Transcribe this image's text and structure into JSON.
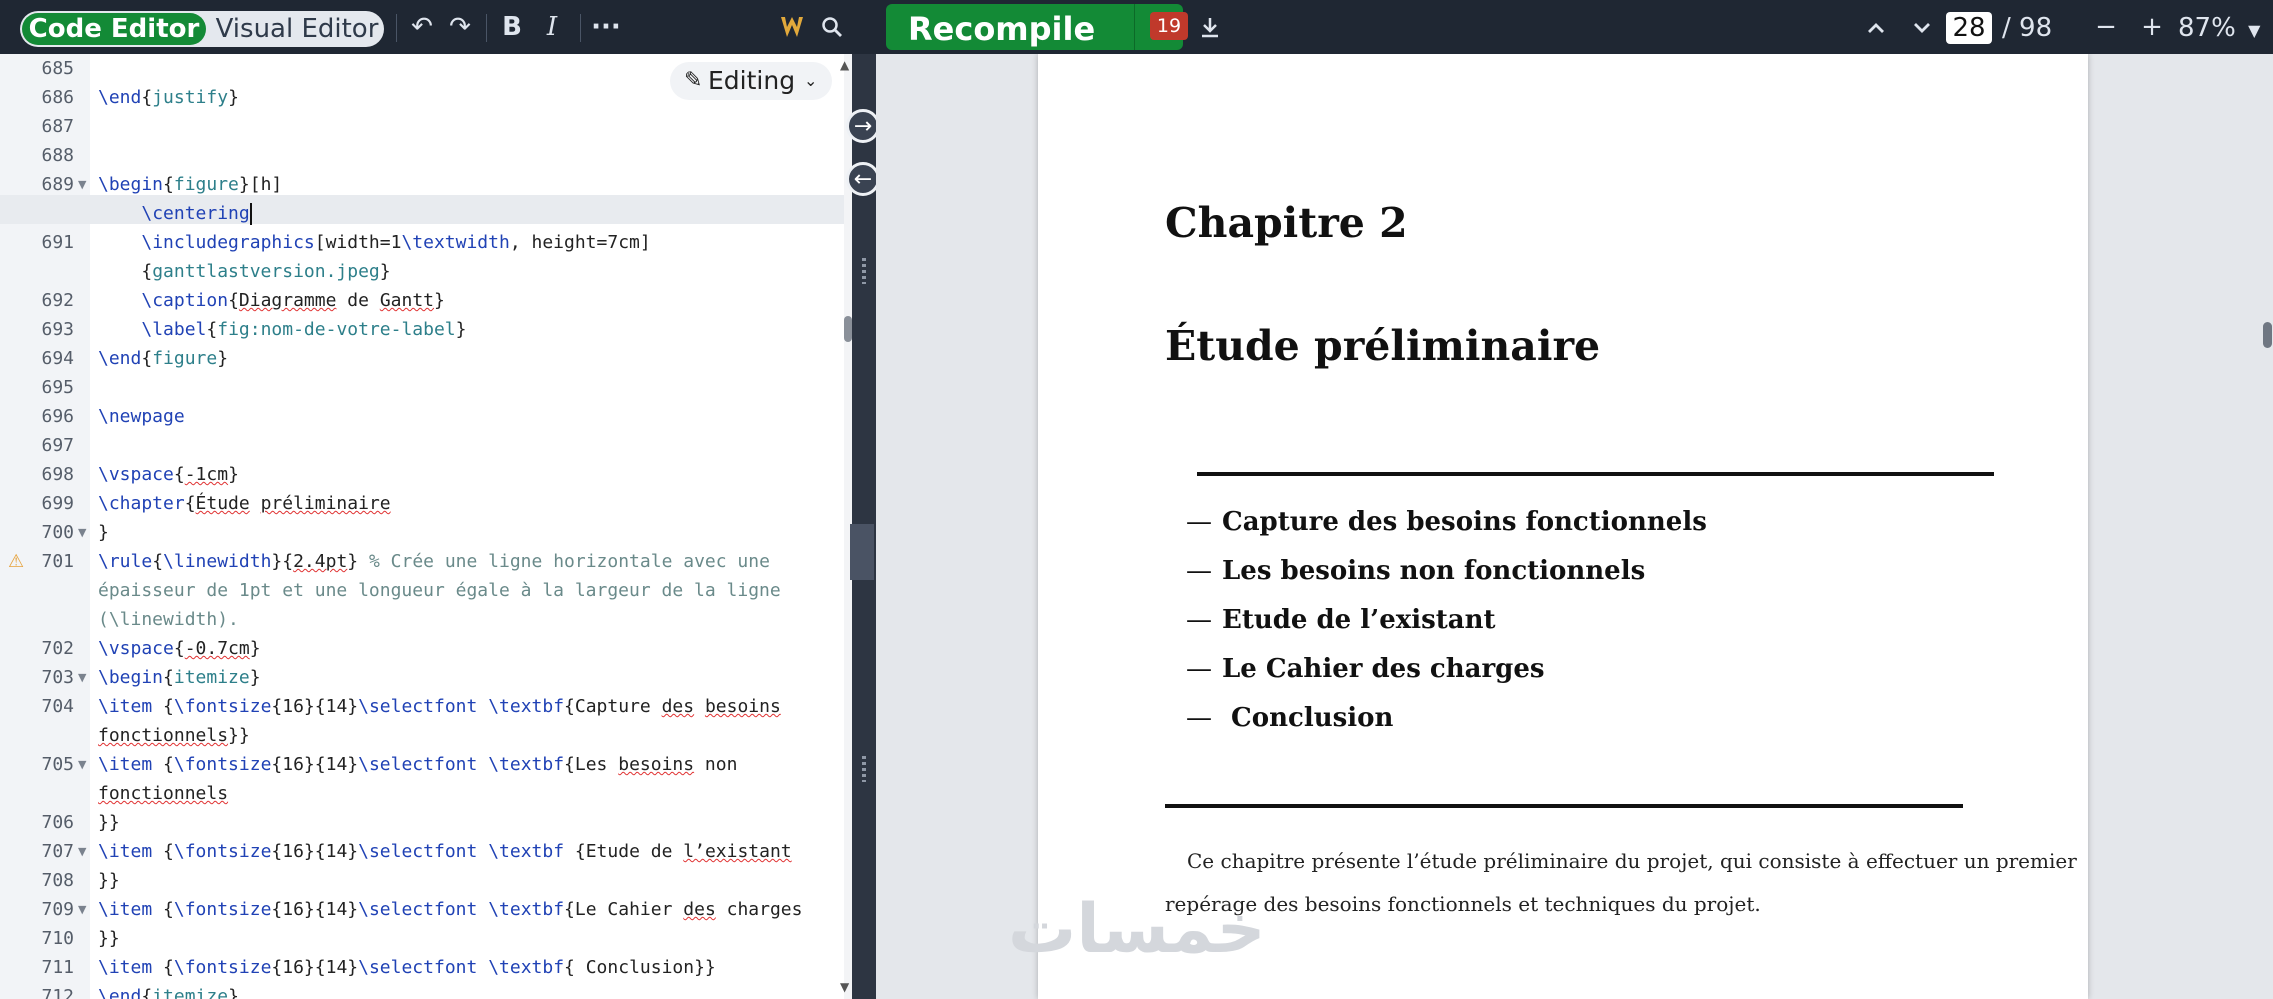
{
  "editor_toolbar": {
    "code_editor_label": "Code Editor",
    "visual_editor_label": "Visual Editor",
    "undo_icon": "undo-icon",
    "redo_icon": "redo-icon",
    "bold_label": "B",
    "italic_label": "I",
    "more_label": "···"
  },
  "pdf_toolbar": {
    "recompile_label": "Recompile",
    "errors_count": "19",
    "current_page": "28",
    "total_pages": "/ 98",
    "zoom_label": "87%",
    "zoom_out_label": "−",
    "zoom_in_label": "+"
  },
  "editing_mode": {
    "label": "Editing"
  },
  "colors": {
    "accent_green": "#138a36",
    "toolbar_bg": "#1f2733",
    "error_red": "#c0392b",
    "warning": "#e6a23c"
  },
  "code_lines": [
    {
      "n": "685",
      "t": ""
    },
    {
      "n": "686",
      "t": "\\end{justify}"
    },
    {
      "n": "687",
      "t": ""
    },
    {
      "n": "688",
      "t": ""
    },
    {
      "n": "689",
      "t": "\\begin{figure}[h]"
    },
    {
      "n": "690",
      "t": "    \\centering"
    },
    {
      "n": "691",
      "t": "    \\includegraphics[width=1\\textwidth, height=7cm]"
    },
    {
      "n": "",
      "t": "    {ganttlastversion.jpeg}"
    },
    {
      "n": "692",
      "t": "    \\caption{Diagramme de Gantt}"
    },
    {
      "n": "693",
      "t": "    \\label{fig:nom-de-votre-label}"
    },
    {
      "n": "694",
      "t": "\\end{figure}"
    },
    {
      "n": "695",
      "t": ""
    },
    {
      "n": "696",
      "t": "\\newpage"
    },
    {
      "n": "697",
      "t": ""
    },
    {
      "n": "698",
      "t": "\\vspace{-1cm}"
    },
    {
      "n": "699",
      "t": "\\chapter{Étude préliminaire"
    },
    {
      "n": "700",
      "t": "}"
    },
    {
      "n": "701",
      "t": "\\rule{\\linewidth}{2.4pt} % Crée une ligne horizontale avec une"
    },
    {
      "n": "",
      "t": "épaisseur de 1pt et une longueur égale à la largeur de la ligne"
    },
    {
      "n": "",
      "t": "(\\linewidth)."
    },
    {
      "n": "702",
      "t": "\\vspace{-0.7cm}"
    },
    {
      "n": "703",
      "t": "\\begin{itemize}"
    },
    {
      "n": "704",
      "t": "\\item {\\fontsize{16}{14}\\selectfont \\textbf{Capture des besoins"
    },
    {
      "n": "",
      "t": "fonctionnels}}"
    },
    {
      "n": "705",
      "t": "\\item {\\fontsize{16}{14}\\selectfont \\textbf{Les besoins non"
    },
    {
      "n": "",
      "t": "fonctionnels"
    },
    {
      "n": "706",
      "t": "}}"
    },
    {
      "n": "707",
      "t": "\\item {\\fontsize{16}{14}\\selectfont \\textbf {Etude de l’existant"
    },
    {
      "n": "708",
      "t": "}}"
    },
    {
      "n": "709",
      "t": "\\item {\\fontsize{16}{14}\\selectfont \\textbf{Le Cahier des charges"
    },
    {
      "n": "710",
      "t": "}}"
    },
    {
      "n": "711",
      "t": "\\item {\\fontsize{16}{14}\\selectfont \\textbf{ Conclusion}}"
    },
    {
      "n": "712",
      "t": "\\end{itemize}"
    }
  ],
  "pdf": {
    "chapter_label": "Chapitre 2",
    "chapter_title": "Étude préliminaire",
    "toc": [
      "Capture des besoins fonctionnels",
      "Les besoins non fonctionnels",
      "Etude de l’existant",
      "Le Cahier des charges",
      " Conclusion"
    ],
    "toc_dash": "—",
    "intro_line1": "Ce chapitre présente l’étude préliminaire du projet, qui consiste à effectuer un premier",
    "intro_line2": "repérage des besoins fonctionnels et techniques du projet.",
    "watermark": "خمسات"
  }
}
